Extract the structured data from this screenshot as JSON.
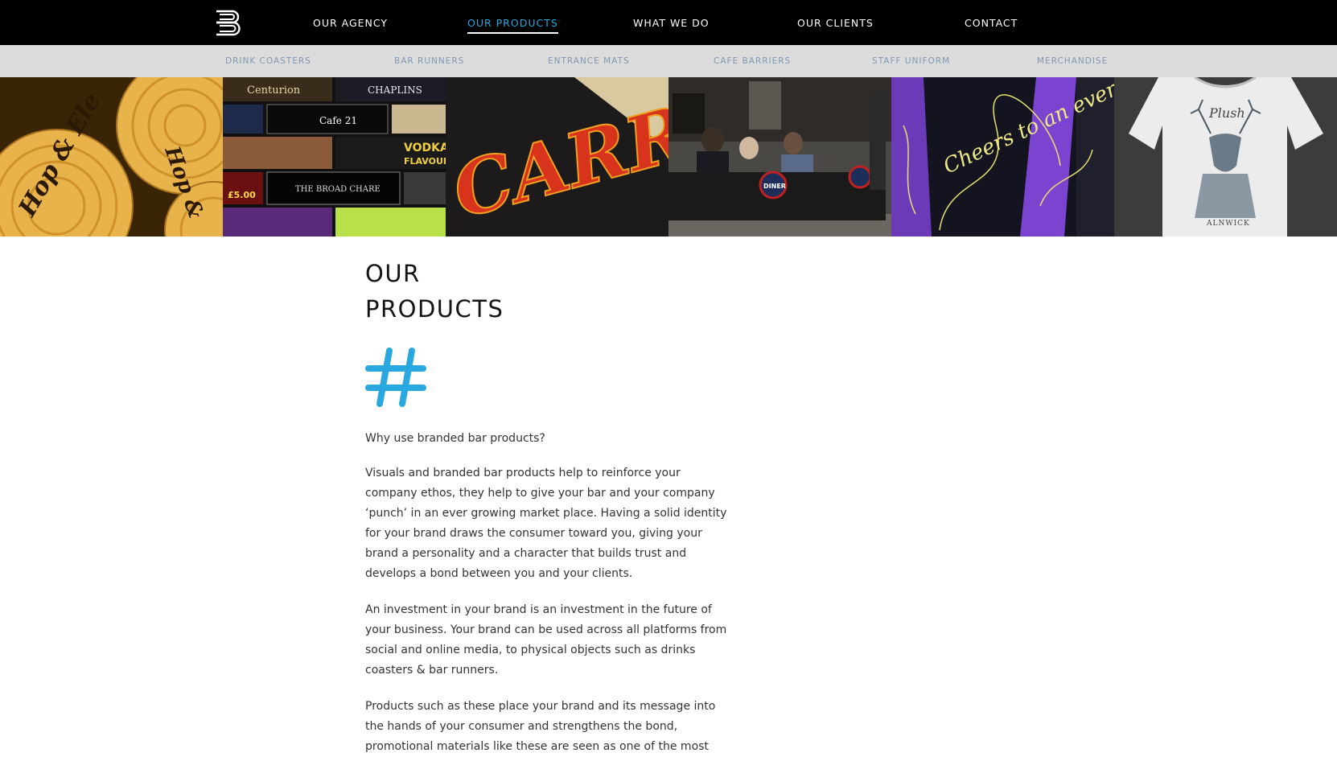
{
  "nav": {
    "items": [
      {
        "label": "OUR AGENCY",
        "active": false
      },
      {
        "label": "OUR PRODUCTS",
        "active": true
      },
      {
        "label": "WHAT WE DO",
        "active": false
      },
      {
        "label": "OUR CLIENTS",
        "active": false
      },
      {
        "label": "CONTACT",
        "active": false
      }
    ],
    "accent_color": "#29a8e0"
  },
  "subnav": {
    "items": [
      {
        "label": "DRINK COASTERS"
      },
      {
        "label": "BAR RUNNERS"
      },
      {
        "label": "ENTRANCE MATS"
      },
      {
        "label": "CAFE BARRIERS"
      },
      {
        "label": "STAFF UNIFORM"
      },
      {
        "label": "MERCHANDISE"
      }
    ]
  },
  "banner": {
    "coasters_text": "Hop & Ele",
    "runner_labels": [
      "Centurion",
      "CHAPLINS",
      "Cafe 21",
      "VODKA",
      "FLAVOUR",
      "THE BROAD CHARE",
      "£5.00"
    ],
    "mat_text": "CARRS",
    "barrier_text": "DINER",
    "uniform_text": "Cheers to an even of unexpe",
    "tshirt_text": "Plush",
    "tshirt_caption": "ALNWICK"
  },
  "main": {
    "title_line1": "OUR",
    "title_line2": "PRODUCTS",
    "hash_icon_color": "#29a8e0",
    "lead": "Why use branded bar products?",
    "paragraphs": [
      "Visuals and branded bar products help to reinforce your company ethos, they help to give your bar and your company ‘punch’ in an ever growing market place. Having a solid identity for your brand draws the consumer toward you, giving your brand a personality and a character that builds trust and develops a bond between you and your clients.",
      "An investment in your brand is an investment in the future of your business. Your brand can be used across all platforms from social and online media, to physical objects such as drinks coasters & bar runners.",
      "Products such as these place your brand and its message into the hands of your consumer and strengthens the bond, promotional materials like these are seen as one of the most"
    ]
  }
}
